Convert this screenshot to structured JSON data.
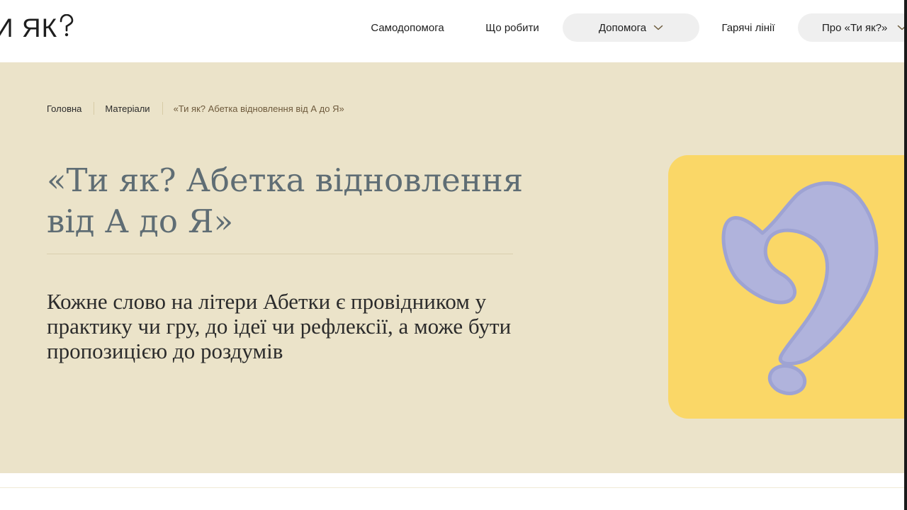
{
  "logo": {
    "text": "И ЯК"
  },
  "nav": {
    "items": [
      {
        "label": "Самодопомога"
      },
      {
        "label": "Що робити"
      },
      {
        "label": "Допомога"
      },
      {
        "label": "Гарячі лінії"
      },
      {
        "label": "Про «Ти як?»"
      }
    ]
  },
  "breadcrumb": {
    "items": [
      {
        "label": "Головна"
      },
      {
        "label": "Матеріали"
      },
      {
        "label": "«Ти як? Абетка відновлення від А до Я»"
      }
    ]
  },
  "hero": {
    "title": "«Ти як? Абетка відновлення від А до Я»",
    "lead": "Кожне слово на літери Абетки є провідником у практику чи гру, до ідеї чи рефлексії, а може бути пропозицією до роздумів"
  },
  "colors": {
    "hero_bg": "#ebe3c9",
    "art_bg": "#fad767",
    "question_mark": "#b0b3dc",
    "title_color": "#5f6d74",
    "pill_bg": "#efefef"
  },
  "icons": {
    "logo_mark": "question-mark-icon",
    "dropdown": "chevron-down-icon",
    "illustration": "question-mark-illustration"
  }
}
